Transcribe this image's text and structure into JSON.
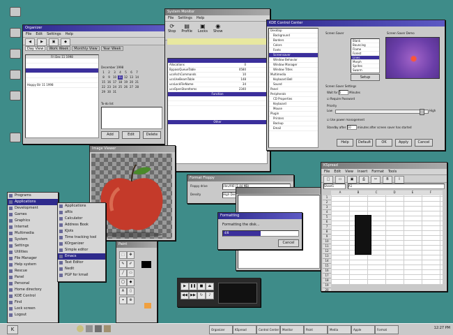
{
  "desktop": {
    "icons": [
      {
        "name": "home-icon",
        "label": ""
      },
      {
        "name": "trash-icon",
        "label": ""
      },
      {
        "name": "floppy-icon",
        "label": ""
      },
      {
        "name": "cdrom-icon",
        "label": ""
      },
      {
        "name": "printer-icon",
        "label": ""
      },
      {
        "name": "network-icon",
        "label": ""
      }
    ]
  },
  "organizer": {
    "title": "Organizer",
    "menu": [
      "File",
      "Edit",
      "Settings",
      "Help"
    ],
    "tabs": [
      "Day View",
      "Work Week",
      "Monthly View",
      "Year Week"
    ],
    "date_header": "Fri Dec 11 1998",
    "note": "Happy Bir 11 1998",
    "calendar_header": "December 1998",
    "calendar_days": [
      "1",
      "2",
      "3",
      "4",
      "5",
      "6",
      "7",
      "8",
      "9",
      "10",
      "11",
      "12",
      "13",
      "14",
      "15",
      "16",
      "17",
      "18",
      "19",
      "20",
      "21",
      "22",
      "23",
      "24",
      "25",
      "26",
      "27",
      "28",
      "29",
      "30",
      "31"
    ],
    "todo_label": "To-do list",
    "buttons": [
      "Add",
      "Edit",
      "Delete"
    ]
  },
  "sysmon": {
    "title": "System Monitor",
    "menu": [
      "File",
      "Settings",
      "Help"
    ],
    "toolbar": [
      "Stop",
      "Profile",
      "Locks",
      "Show"
    ],
    "rows": [
      [
        "Allocations",
        "0"
      ],
      [
        "BypassQueueTable",
        "0580"
      ],
      [
        "ucsArchCommands",
        "10"
      ],
      [
        "ucsUseBeamTable",
        "148"
      ],
      [
        "ucsLockFileName",
        "34"
      ],
      [
        "ucsOpenStoreItems",
        "2340"
      ]
    ],
    "section_function": "Function",
    "section_other": "Other"
  },
  "control_center": {
    "title": "KDE Control Center",
    "tree": [
      "Desktop",
      "Background",
      "Borders",
      "Colors",
      "Fonts",
      "Screensaver",
      "Window Behavior",
      "Window Manager",
      "Window Titles",
      "Multimedia",
      "Keyboard Bell",
      "Sound",
      "Panel",
      "Peripherals",
      "CD Properties",
      "Keyboard",
      "Mouse",
      "Plugin",
      "Printers",
      "Backup",
      "Email",
      "File Sharing"
    ],
    "screensaver_label": "Screen Saver",
    "preview_label": "Screen Saver Demo",
    "savers": [
      "Blank",
      "Bouncing",
      "Flame",
      "Forest",
      "Lines",
      "Morph",
      "Sprites",
      "Swarm",
      "Science"
    ],
    "setup_button": "Setup",
    "settings_label": "Screen Saver Settings",
    "wait_label": "Wait for",
    "wait_value": "5",
    "wait_unit": "Minutes",
    "require_password": "Require Password",
    "priority_label": "Priority",
    "low_label": "Low",
    "high_label": "High",
    "power_label": "Use power management",
    "standby_label": "Standby after",
    "standby_value": "10",
    "standby_unit": "minutes after screen saver has started",
    "buttons": [
      "Help",
      "Default",
      "OK",
      "Apply",
      "Cancel"
    ]
  },
  "apple_viewer": {
    "title": "Image Viewer"
  },
  "dialog": {
    "title": "Formatting",
    "message": "Formatting the disk...",
    "progress_text": "4/8",
    "progress": 0.5,
    "cancel_button": "Cancel"
  },
  "format_dialog": {
    "title": "Format Floppy",
    "label1": "Floppy drive",
    "value1": "/dev/fd0 (1.44 MB)",
    "label2": "Density",
    "value2": "High Density 3.5\" (1.44 MB)"
  },
  "spreadsheet": {
    "title": "KSpread",
    "menu": [
      "File",
      "Edit",
      "View",
      "Insert",
      "Format",
      "Tools"
    ],
    "cell_ref": "Sheet1",
    "formula": "A1",
    "columns": [
      "A",
      "B",
      "C",
      "D",
      "E",
      "F"
    ],
    "rows": [
      "1",
      "2",
      "3",
      "4",
      "5",
      "6",
      "7",
      "8",
      "9",
      "10",
      "11",
      "12",
      "13",
      "14",
      "15",
      "16",
      "17",
      "18",
      "19",
      "20",
      "21",
      "22",
      "23"
    ]
  },
  "paint": {
    "title": "Paint"
  },
  "media_player": {
    "title": "Media Player"
  },
  "start_menu": {
    "main": [
      "Programs",
      "Applications",
      "Development",
      "Games",
      "Graphics",
      "Internet",
      "Multimedia",
      "System",
      "Settings",
      "Utilities",
      "File Manager",
      "Help system",
      "Rescue",
      "Panel",
      "Personal",
      "Home directory",
      "KDE Control",
      "Find",
      "Lock screen",
      "Logout"
    ],
    "sub": [
      "Applications",
      "aRts",
      "Calculator",
      "Address Book",
      "KJots",
      "Time tracking tool",
      "KOrganizer",
      "Simple editor",
      "Emacs",
      "Text Editor",
      "Nedit",
      "PGP for kmail"
    ]
  },
  "taskbar": {
    "items": [
      "Organizer",
      "KSpread",
      "Control Center",
      "Monitor",
      "Paint",
      "Media",
      "Apple",
      "Format"
    ],
    "clock": "12:27 PM"
  }
}
